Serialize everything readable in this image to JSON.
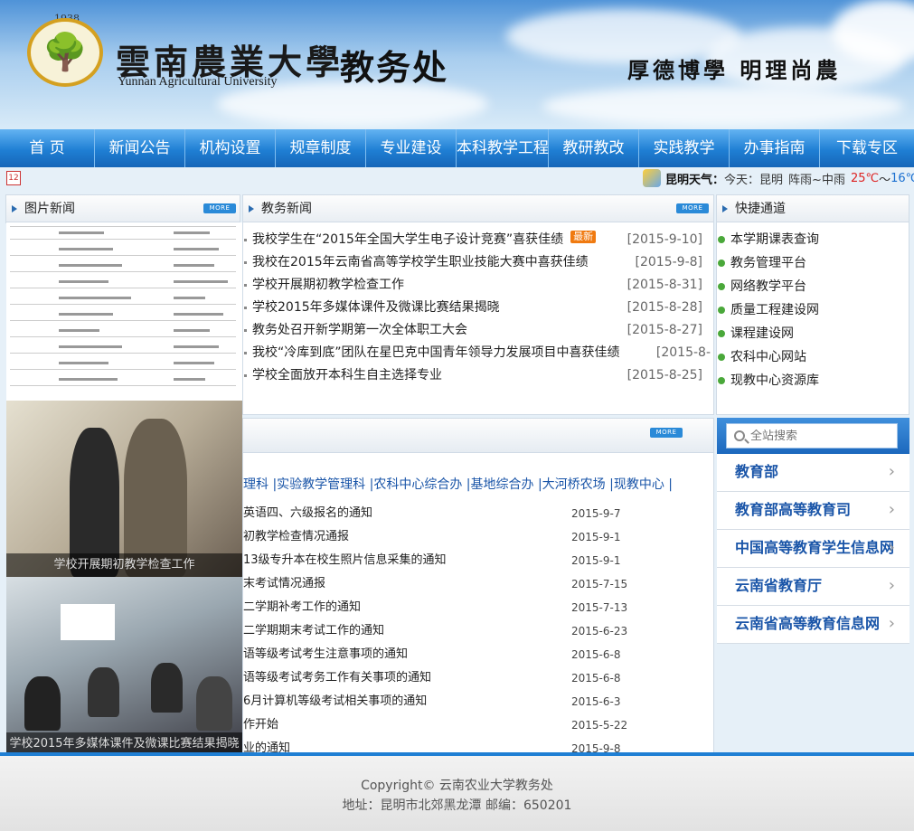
{
  "header": {
    "logo_year": "1938",
    "school_name_cn": "雲南農業大學",
    "school_name_en": "Yunnan Agricultural University",
    "department": "教务处",
    "motto": "厚德博學  明理尚農"
  },
  "nav": {
    "items": [
      {
        "label": "首 页"
      },
      {
        "label": "新闻公告"
      },
      {
        "label": "机构设置"
      },
      {
        "label": "规章制度"
      },
      {
        "label": "专业建设"
      },
      {
        "label": "本科教学工程"
      },
      {
        "label": "教研教改"
      },
      {
        "label": "实践教学"
      },
      {
        "label": "办事指南"
      },
      {
        "label": "下载专区"
      }
    ]
  },
  "date_badge": "12",
  "weather": {
    "label": "昆明天气：",
    "today": "今天：",
    "city": "昆明",
    "condition": "阵雨~中雨",
    "high": "25℃",
    "sep": "～",
    "low": "16℃"
  },
  "photo_news": {
    "title": "图片新闻",
    "more": "MORE",
    "captions": [
      "学校开展期初教学检查工作",
      "学校2015年多媒体课件及微课比赛结果揭晓"
    ]
  },
  "affairs_news": {
    "title": "教务新闻",
    "more": "MORE",
    "new_badge": "最新",
    "items": [
      {
        "title": "我校学生在“2015年全国大学生电子设计竞赛”喜获佳绩",
        "date": "[2015-9-10]",
        "is_new": true
      },
      {
        "title": "我校在2015年云南省高等学校学生职业技能大赛中喜获佳绩",
        "date": "[2015-9-8]"
      },
      {
        "title": "学校开展期初教学检查工作",
        "date": "[2015-8-31]"
      },
      {
        "title": "学校2015年多媒体课件及微课比赛结果揭晓",
        "date": "[2015-8-28]"
      },
      {
        "title": "教务处召开新学期第一次全体职工大会",
        "date": "[2015-8-27]"
      },
      {
        "title": "我校“冷库到底”团队在星巴克中国青年领导力发展项目中喜获佳绩",
        "date": "[2015-8-"
      },
      {
        "title": "学校全面放开本科生自主选择专业",
        "date": "[2015-8-25]"
      }
    ]
  },
  "quick_links": {
    "title": "快捷通道",
    "items": [
      "本学期课表查询",
      "教务管理平台",
      "网络教学平台",
      "质量工程建设网",
      "课程建设网",
      "农科中心网站",
      "现教中心资源库"
    ]
  },
  "notices": {
    "more": "MORE",
    "categories": "理科 |实验教学管理科 |农科中心综合办 |基地综合办 |大河桥农场 |现教中心 |",
    "items": [
      {
        "title": "英语四、六级报名的通知",
        "date": "2015-9-7"
      },
      {
        "title": "初教学检查情况通报",
        "date": "2015-9-1"
      },
      {
        "title": "13级专升本在校生照片信息采集的通知",
        "date": "2015-9-1"
      },
      {
        "title": "末考试情况通报",
        "date": "2015-7-15"
      },
      {
        "title": "二学期补考工作的通知",
        "date": "2015-7-13"
      },
      {
        "title": "二学期期末考试工作的通知",
        "date": "2015-6-23"
      },
      {
        "title": "语等级考试考生注意事项的通知",
        "date": "2015-6-8"
      },
      {
        "title": "语等级考试考务工作有关事项的通知",
        "date": "2015-6-8"
      },
      {
        "title": "6月计算机等级考试相关事项的通知",
        "date": "2015-6-3"
      },
      {
        "title": "作开始",
        "date": "2015-5-22"
      },
      {
        "title": "业的通知",
        "date": "2015-9-8"
      }
    ]
  },
  "search": {
    "placeholder": "全站搜索"
  },
  "external_links": [
    "教育部",
    "教育部高等教育司",
    "中国高等教育学生信息网",
    "云南省教育厅",
    "云南省高等教育信息网"
  ],
  "footer": {
    "copyright": "Copyright© 云南农业大学教务处",
    "address": "地址：昆明市北郊黑龙潭 邮编：650201"
  }
}
